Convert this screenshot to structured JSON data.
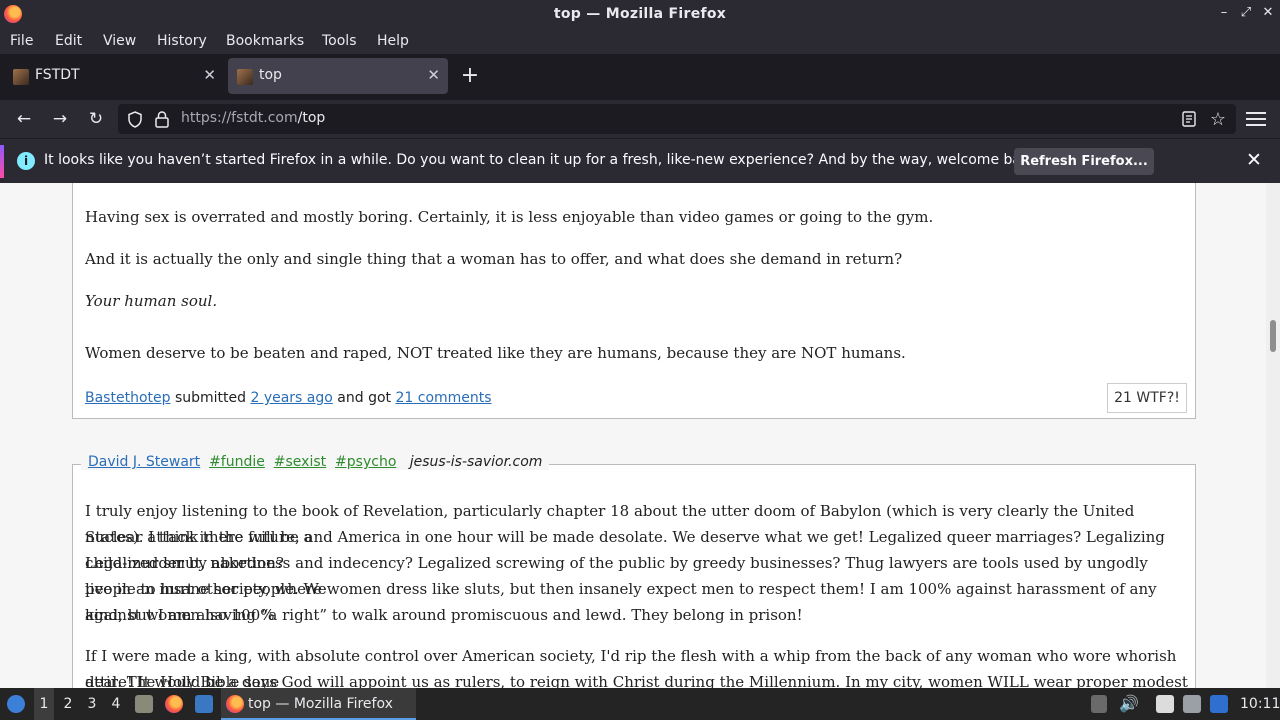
{
  "window": {
    "title": "top — Mozilla Firefox"
  },
  "menu": [
    "File",
    "Edit",
    "View",
    "History",
    "Bookmarks",
    "Tools",
    "Help"
  ],
  "tabs": [
    {
      "label": "FSTDT",
      "active": false
    },
    {
      "label": "top",
      "active": true
    }
  ],
  "nav": {
    "url_host": "https://fstdt.com",
    "url_path": "/top"
  },
  "notification": {
    "text": "It looks like you haven’t started Firefox in a while. Do you want to clean it up for a fresh, like-new experience? And by the way, welcome back!",
    "button": "Refresh Firefox..."
  },
  "post1": {
    "paragraphs": [
      "Having sex is overrated and mostly boring. Certainly, it is less enjoyable than video games or going to the gym.",
      "And it is actually the only and single thing that a woman has to offer, and what does she demand in return?",
      "Your human soul.",
      "Women deserve to be beaten and raped, NOT treated like they are humans, because they are NOT humans."
    ],
    "author": "Bastethotep",
    "submitted": "submitted",
    "time": "2 years ago",
    "and_got": "and got",
    "comments": "21 comments",
    "wtf": "21 WTF?!"
  },
  "post2": {
    "author": "David J. Stewart",
    "tags": [
      "#fundie",
      "#sexist",
      "#psycho"
    ],
    "site": "jesus-is-savior.com",
    "paragraph1_lines": [
      "I truly enjoy listening to the book of Revelation, particularly chapter 18 about the utter doom of Babylon (which is very clearly the United States). I think there will be a",
      "nuclear attack in the future, and America in one hour will be made desolate. We deserve what we get! Legalized queer marriages? Legalizing child-murder by abortion?",
      "Legalized smut, nakedness and indecency? Legalized screwing of the public by greedy businesses? Thug lawyers are tools used by ungodly people to hurt other people. We",
      "live in an insane society, where women dress like sluts, but then insanely expect men to respect them! I am 100% against harassment of any kind, but I am also 100%",
      "against women having “a right” to walk around promiscuous and lewd. They belong in prison!"
    ],
    "paragraph2_lines": [
      "If I were made a king, with absolute control over American society, I'd rip the flesh with a whip from the back of any woman who wore whorish attire! It would be a done",
      "deal. The Holy Bible says God will appoint us as rulers, to reign with Christ during the Millennium. In my city, women WILL wear proper modest attire, or you will beg"
    ]
  },
  "taskbar": {
    "workspaces": [
      "1",
      "2",
      "3",
      "4"
    ],
    "window_label": "top — Mozilla Firefox",
    "clock": "10:11"
  }
}
